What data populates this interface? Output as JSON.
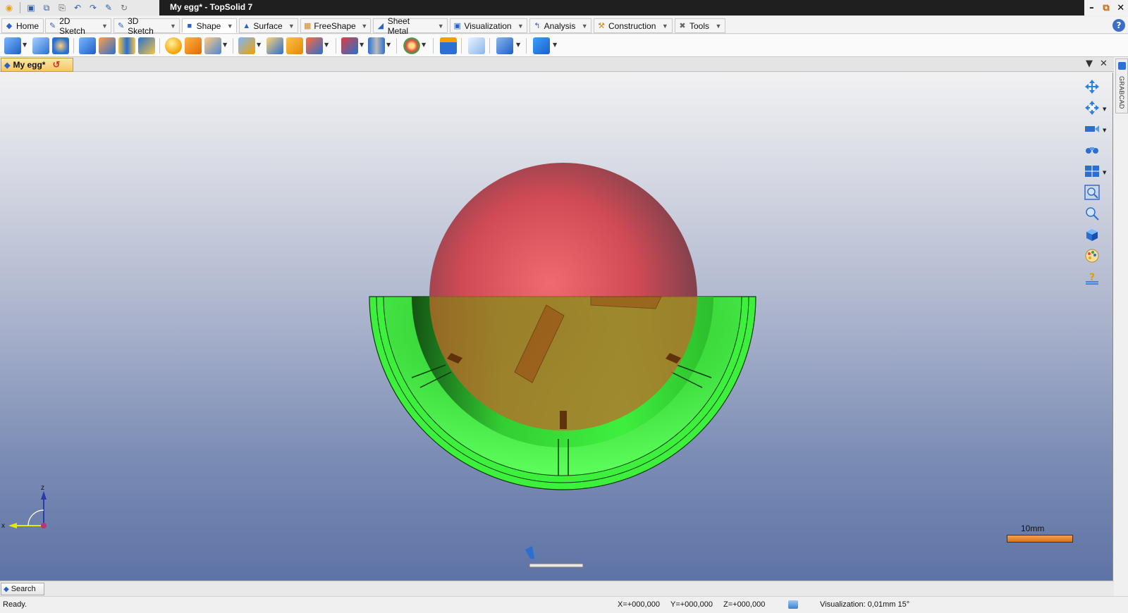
{
  "window": {
    "title": "My egg* - TopSolid 7",
    "controls": [
      "minimize-icon",
      "restore-icon",
      "close-icon"
    ]
  },
  "quick_access": [
    "app-menu-icon",
    "save-icon",
    "save-all-icon",
    "print-icon",
    "undo-icon",
    "redo-icon",
    "pen-icon",
    "refresh-icon"
  ],
  "ribbon_tabs": [
    {
      "label": "Home",
      "icon": "home-icon",
      "active": false
    },
    {
      "label": "2D Sketch",
      "icon": "sketch-2d-icon",
      "active": false
    },
    {
      "label": "3D Sketch",
      "icon": "sketch-3d-icon",
      "active": false
    },
    {
      "label": "Shape",
      "icon": "shape-icon",
      "active": true
    },
    {
      "label": "Surface",
      "icon": "surface-icon",
      "active": false
    },
    {
      "label": "FreeShape",
      "icon": "freeshape-icon",
      "active": false
    },
    {
      "label": "Sheet Metal",
      "icon": "sheet-metal-icon",
      "active": false
    },
    {
      "label": "Visualization",
      "icon": "visualization-icon",
      "active": false
    },
    {
      "label": "Analysis",
      "icon": "analysis-icon",
      "active": false
    },
    {
      "label": "Construction",
      "icon": "construction-icon",
      "active": false
    },
    {
      "label": "Tools",
      "icon": "tools-icon",
      "active": false
    }
  ],
  "document": {
    "tab_label": "My egg*"
  },
  "side_panel": {
    "label": "GRABCAD"
  },
  "viewport": {
    "axis_z": "z",
    "axis_x": "x",
    "scale_label": "10mm",
    "colors": {
      "sphere": "#d9505a",
      "half_shell": "#3cf03c",
      "scale_bar": "#e8842c"
    }
  },
  "search": {
    "label": "Search"
  },
  "status": {
    "message": "Ready.",
    "x": "X=+000,000",
    "y": "Y=+000,000",
    "z": "Z=+000,000",
    "visualization": "Visualization: 0,01mm 15°"
  }
}
